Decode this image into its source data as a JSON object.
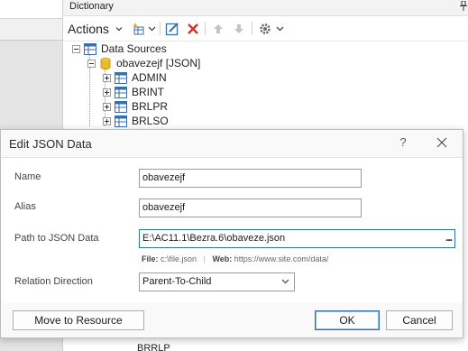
{
  "dictionary": {
    "title": "Dictionary",
    "toolbar": {
      "actions_label": "Actions",
      "icons": [
        "new-item-icon",
        "edit-icon",
        "delete-icon",
        "move-up-icon",
        "move-down-icon",
        "settings-icon"
      ]
    },
    "tree": {
      "root_label": "Data Sources",
      "source_label": "obavezejf [JSON]",
      "children": [
        "ADMIN",
        "BRINT",
        "BRLPR",
        "BRLSO"
      ],
      "bottom_peek": "BRRLP"
    }
  },
  "dialog": {
    "title": "Edit JSON Data",
    "help_label": "?",
    "fields": {
      "name_label": "Name",
      "name_value": "obavezejf",
      "alias_label": "Alias",
      "alias_value": "obavezejf",
      "path_label": "Path to JSON Data",
      "path_value": "E:\\AC11.1\\Bezra.6\\obaveze.json",
      "browse_label": "...",
      "hint_file_key": "File:",
      "hint_file_value": "c:\\file.json",
      "hint_sep": "|",
      "hint_web_key": "Web:",
      "hint_web_value": "https://www.site.com/data/",
      "relation_label": "Relation Direction",
      "relation_value": "Parent-To-Child"
    },
    "buttons": {
      "move_to_resource": "Move to Resource",
      "ok": "OK",
      "cancel": "Cancel"
    }
  },
  "colors": {
    "accent": "#2f6fb5",
    "delete_red": "#d93025",
    "table_icon": "#3a6ea8",
    "db_icon": "#e8b931"
  }
}
